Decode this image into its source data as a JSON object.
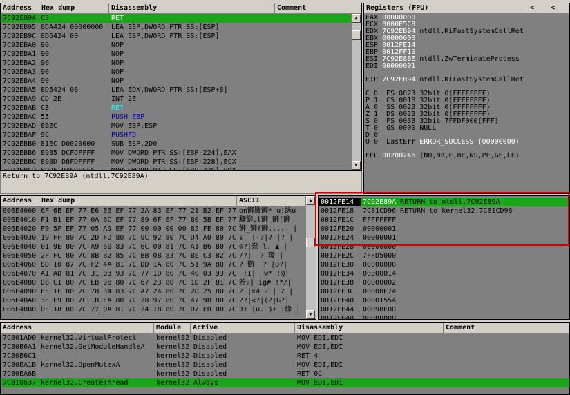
{
  "colors": {
    "pane_bg": "#808080",
    "selection": "#19a619",
    "highlight_box": "#d00000",
    "value_white": "#ffffff",
    "ret_cyan": "#00ffff",
    "call_blue": "#0000a0"
  },
  "cpu": {
    "headers": {
      "address": "Address",
      "hex": "Hex dump",
      "disasm": "Disassembly",
      "comment": "Comment"
    },
    "rows": [
      {
        "addr": "7C92EB94",
        "hex": "C3",
        "dis": "RET",
        "style": "ret",
        "sel": true
      },
      {
        "addr": "7C92EB95",
        "hex": "8DA424 00000000",
        "dis": "LEA ESP,DWORD PTR SS:[ESP]"
      },
      {
        "addr": "7C92EB9C",
        "hex": "8D6424 00",
        "dis": "LEA ESP,DWORD PTR SS:[ESP]"
      },
      {
        "addr": "7C92EBA0",
        "hex": "90",
        "dis": "NOP"
      },
      {
        "addr": "7C92EBA1",
        "hex": "90",
        "dis": "NOP"
      },
      {
        "addr": "7C92EBA2",
        "hex": "90",
        "dis": "NOP"
      },
      {
        "addr": "7C92EBA3",
        "hex": "90",
        "dis": "NOP"
      },
      {
        "addr": "7C92EBA4",
        "hex": "90",
        "dis": "NOP"
      },
      {
        "addr": "7C92EBA5",
        "hex": "8D5424 08",
        "dis": "LEA EDX,DWORD PTR SS:[ESP+8]"
      },
      {
        "addr": "7C92EBA9",
        "hex": "CD 2E",
        "dis": "INT 2E"
      },
      {
        "addr": "7C92EBAB",
        "hex": "C3",
        "dis": "RET",
        "style": "ret"
      },
      {
        "addr": "7C92EBAC",
        "hex": "55",
        "dis": "PUSH EBP",
        "style": "blue"
      },
      {
        "addr": "7C92EBAD",
        "hex": "8BEC",
        "dis": "MOV EBP,ESP"
      },
      {
        "addr": "7C92EBAF",
        "hex": "9C",
        "dis": "PUSHFD",
        "style": "blue"
      },
      {
        "addr": "7C92EBB0",
        "hex": "81EC D0020000",
        "dis": "SUB ESP,2D0"
      },
      {
        "addr": "7C92EBB6",
        "hex": "8985 DCFDFFFF",
        "dis": "MOV DWORD PTR SS:[EBP-224],EAX"
      },
      {
        "addr": "7C92EBBC",
        "hex": "898D D8FDFFFF",
        "dis": "MOV DWORD PTR SS:[EBP-228],ECX"
      },
      {
        "addr": "7C92EBC2",
        "hex": "8995 D4FDFFFF",
        "dis": "MOV DWORD PTR SS:[EBP-22C],EDX"
      }
    ],
    "info": "Return to 7C92E89A (ntdll.7C92E89A)"
  },
  "registers": {
    "title": "Registers (FPU)",
    "lines": [
      [
        {
          "t": "EAX "
        },
        {
          "t": "00000000",
          "c": "white"
        }
      ],
      [
        {
          "t": "ECX "
        },
        {
          "t": "0000E5C8",
          "c": "white"
        }
      ],
      [
        {
          "t": "EDX "
        },
        {
          "t": "7C92EB94",
          "c": "white"
        },
        {
          "t": " ntdll.KiFastSystemCallRet"
        }
      ],
      [
        {
          "t": "EBX "
        },
        {
          "t": "00000000",
          "c": "white"
        }
      ],
      [
        {
          "t": "ESP "
        },
        {
          "t": "0012FE14",
          "c": "white"
        }
      ],
      [
        {
          "t": "EBP "
        },
        {
          "t": "0012FF10",
          "c": "white"
        }
      ],
      [
        {
          "t": "ESI "
        },
        {
          "t": "7C92E88E",
          "c": "white"
        },
        {
          "t": " ntdll.ZwTerminateProcess"
        }
      ],
      [
        {
          "t": "EDI "
        },
        {
          "t": "00000001",
          "c": "white"
        }
      ],
      [
        {
          "t": ""
        }
      ],
      [
        {
          "t": "EIP "
        },
        {
          "t": "7C92EB94",
          "c": "white"
        },
        {
          "t": " ntdll.KiFastSystemCallRet"
        }
      ],
      [
        {
          "t": ""
        }
      ],
      [
        {
          "t": "C 0  ES 0023 32bit 0(FFFFFFFF)"
        }
      ],
      [
        {
          "t": "P 1  CS 001B 32bit 0(FFFFFFFF)"
        }
      ],
      [
        {
          "t": "A 0  SS 0023 32bit 0(FFFFFFFF)"
        }
      ],
      [
        {
          "t": "Z 1  DS 0023 32bit 0(FFFFFFFF)"
        }
      ],
      [
        {
          "t": "S 0  FS 003B 32bit 7FFDF000(FFF)"
        }
      ],
      [
        {
          "t": "T 0  GS 0000 NULL"
        }
      ],
      [
        {
          "t": "D 0"
        }
      ],
      [
        {
          "t": "O 0  LastErr "
        },
        {
          "t": "ERROR_SUCCESS (00000000)",
          "c": "white"
        }
      ],
      [
        {
          "t": ""
        }
      ],
      [
        {
          "t": "EFL "
        },
        {
          "t": "00200246",
          "c": "white"
        },
        {
          "t": " (NO,NB,E,BE,NS,PE,GE,LE)"
        }
      ]
    ]
  },
  "dump": {
    "headers": {
      "address": "Address",
      "hex": "Hex dump",
      "ascii": "ASCII"
    },
    "rows": [
      {
        "addr": "006E4000",
        "hex": "6F 6E EF 77 E6 E6 EF 77 2A 83 EF 77 21 B2 EF 77",
        "ascii": "on飹賸飹* u!詠u"
      },
      {
        "addr": "006E4010",
        "hex": "F1 B1 EF 77 0A 6C EF 77 89 6F EF 77 80 5B EF 77",
        "ascii": "驟飹.l飹 飹[飹"
      },
      {
        "addr": "006E4020",
        "hex": "F0 5F EF 77 05 A9 EF 77 00 00 00 00 82 FE 80 7C",
        "ascii": "飹_飹f飹....  |"
      },
      {
        "addr": "006E4030",
        "hex": "19 FF 80 7C 2D FD 80 7C 9C 92 80 7C D4 A0 80 7C",
        "ascii": "↓  |-?|? |? |"
      },
      {
        "addr": "006E4040",
        "hex": "01 9E 80 7C A9 60 83 7C 6C 00 81 7C A1 B6 80 7C",
        "ascii": "⊙?|奈 l. ▲ |"
      },
      {
        "addr": "006E4050",
        "hex": "2F FC 80 7C 8B B2 85 7C BB 0B 83 7C BE C3 82 7C",
        "ascii": "/?|  ? 瓊 |"
      },
      {
        "addr": "006E4060",
        "hex": "8D 10 87 7C F2 4A 81 7C DD 1A 80 7C 51 9A 80 7C",
        "ascii": "? 衛  ? |Q?|"
      },
      {
        "addr": "006E4070",
        "hex": "A1 AD 81 7C 31 03 93 7C 77 1D 80 7C 40 03 93 7C",
        "ascii": " !1|  w* !@|"
      },
      {
        "addr": "006E4080",
        "hex": "D8 C1 80 7C EB 98 80 7C 67 23 80 7C 1D 2F 81 7C",
        "ascii": "貯?| ig# !*/|"
      },
      {
        "addr": "006E4090",
        "hex": "EE 1E 80 7C 78 34 83 7C A7 24 80 7C 2D 25 80 7C",
        "ascii": "? |x4 ? | Z |"
      },
      {
        "addr": "006E40A0",
        "hex": "3F E9 80 7C 1B EA 80 7C 28 97 80 7C 47 9B 80 7C",
        "ascii": "??|<?|(?|G?|"
      },
      {
        "addr": "006E40B0",
        "hex": "DE 18 80 7C 77 0A 81 7C 24 18 80 7C D7 ED 80 7C",
        "ascii": "J↑ |u. $↑ |緣 |"
      }
    ]
  },
  "stack": {
    "rows": [
      {
        "addr": "0012FE14",
        "val": "7C92E89A",
        "cmt": "RETURN to ntdll.7C92E89A",
        "sel": true
      },
      {
        "addr": "0012FE18",
        "val": "7C81CD96",
        "cmt": "RETURN to kernel32.7C81CD96"
      },
      {
        "addr": "0012FE1C",
        "val": "FFFFFFFF",
        "cmt": ""
      },
      {
        "addr": "0012FE20",
        "val": "00000001",
        "cmt": ""
      },
      {
        "addr": "0012FE24",
        "val": "00000001",
        "cmt": ""
      },
      {
        "addr": "0012FE28",
        "val": "00000000",
        "cmt": ""
      },
      {
        "addr": "0012FE2C",
        "val": "7FFD5000",
        "cmt": ""
      },
      {
        "addr": "0012FE30",
        "val": "00000000",
        "cmt": ""
      },
      {
        "addr": "0012FE34",
        "val": "00300014",
        "cmt": ""
      },
      {
        "addr": "0012FE38",
        "val": "00000002",
        "cmt": ""
      },
      {
        "addr": "0012FE3C",
        "val": "00000E74",
        "cmt": ""
      },
      {
        "addr": "0012FE40",
        "val": "00001554",
        "cmt": ""
      },
      {
        "addr": "0012FE44",
        "val": "00098E0D",
        "cmt": ""
      },
      {
        "addr": "0012FE48",
        "val": "00000000",
        "cmt": ""
      }
    ]
  },
  "breakpoints": {
    "headers": {
      "address": "Address",
      "module": "Module",
      "active": "Active",
      "disasm": "Disassembly",
      "comment": "Comment"
    },
    "rows": [
      {
        "addr": "7C801AD0",
        "name": "kernel32.VirtualProtect",
        "module": "kernel32",
        "active": "Disabled",
        "dis": "MOV EDI,EDI"
      },
      {
        "addr": "7C80B6A1",
        "name": "kernel32.GetModuleHandleA",
        "module": "kernel32",
        "active": "Disabled",
        "dis": "MOV EDI,EDI"
      },
      {
        "addr": "7C80B6C1",
        "name": "",
        "module": "kernel32",
        "active": "Disabled",
        "dis": "RET 4"
      },
      {
        "addr": "7C80EA1B",
        "name": "kernel32.OpenMutexA",
        "module": "kernel32",
        "active": "Disabled",
        "dis": "MOV EDI,EDI"
      },
      {
        "addr": "7C80EA6B",
        "name": "",
        "module": "kernel32",
        "active": "Disabled",
        "dis": "RET 0C"
      },
      {
        "addr": "7C810637",
        "name": "kernel32.CreateThread",
        "module": "kernel32",
        "active": "Always",
        "dis": "MOV EDI,EDI",
        "sel": true
      }
    ]
  }
}
